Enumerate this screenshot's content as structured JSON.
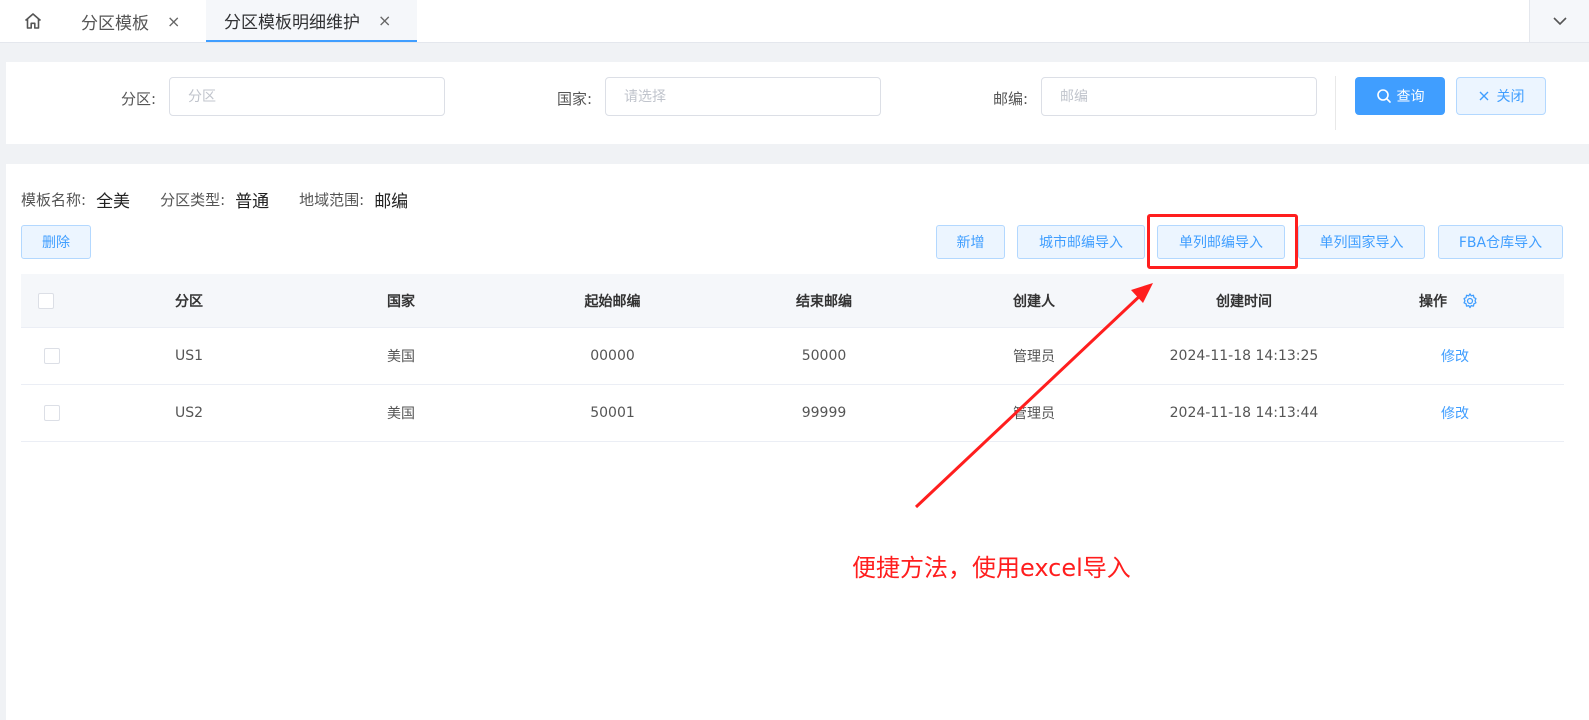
{
  "tabs": {
    "home_icon": "home-icon",
    "items": [
      {
        "label": "分区模板",
        "close": "×"
      },
      {
        "label": "分区模板明细维护",
        "close": "×"
      }
    ],
    "more_icon": "chevron-down-icon"
  },
  "search": {
    "zone_label": "分区:",
    "zone_placeholder": "分区",
    "country_label": "国家:",
    "country_placeholder": "请选择",
    "postcode_label": "邮编:",
    "postcode_placeholder": "邮编",
    "query_label": "查询",
    "close_label": "关闭"
  },
  "template_info": {
    "name_label": "模板名称:",
    "name_value": "全美",
    "type_label": "分区类型:",
    "type_value": "普通",
    "scope_label": "地域范围:",
    "scope_value": "邮编"
  },
  "toolbar": {
    "delete_label": "删除",
    "add_label": "新增",
    "city_import_label": "城市邮编导入",
    "single_postcode_import_label": "单列邮编导入",
    "single_country_import_label": "单列国家导入",
    "fba_import_label": "FBA仓库导入"
  },
  "table": {
    "headers": {
      "zone": "分区",
      "country": "国家",
      "start_postcode": "起始邮编",
      "end_postcode": "结束邮编",
      "creator": "创建人",
      "created_time": "创建时间",
      "operation": "操作"
    },
    "rows": [
      {
        "zone": "US1",
        "country": "美国",
        "start_postcode": "00000",
        "end_postcode": "50000",
        "creator": "管理员",
        "created_time": "2024-11-18 14:13:25",
        "action": "修改"
      },
      {
        "zone": "US2",
        "country": "美国",
        "start_postcode": "50001",
        "end_postcode": "99999",
        "creator": "管理员",
        "created_time": "2024-11-18 14:13:44",
        "action": "修改"
      }
    ]
  },
  "annotation": {
    "text": "便捷方法，使用excel导入",
    "color": "#ff1e1e"
  },
  "colors": {
    "primary": "#409eff",
    "primary_light": "#ecf5ff"
  }
}
